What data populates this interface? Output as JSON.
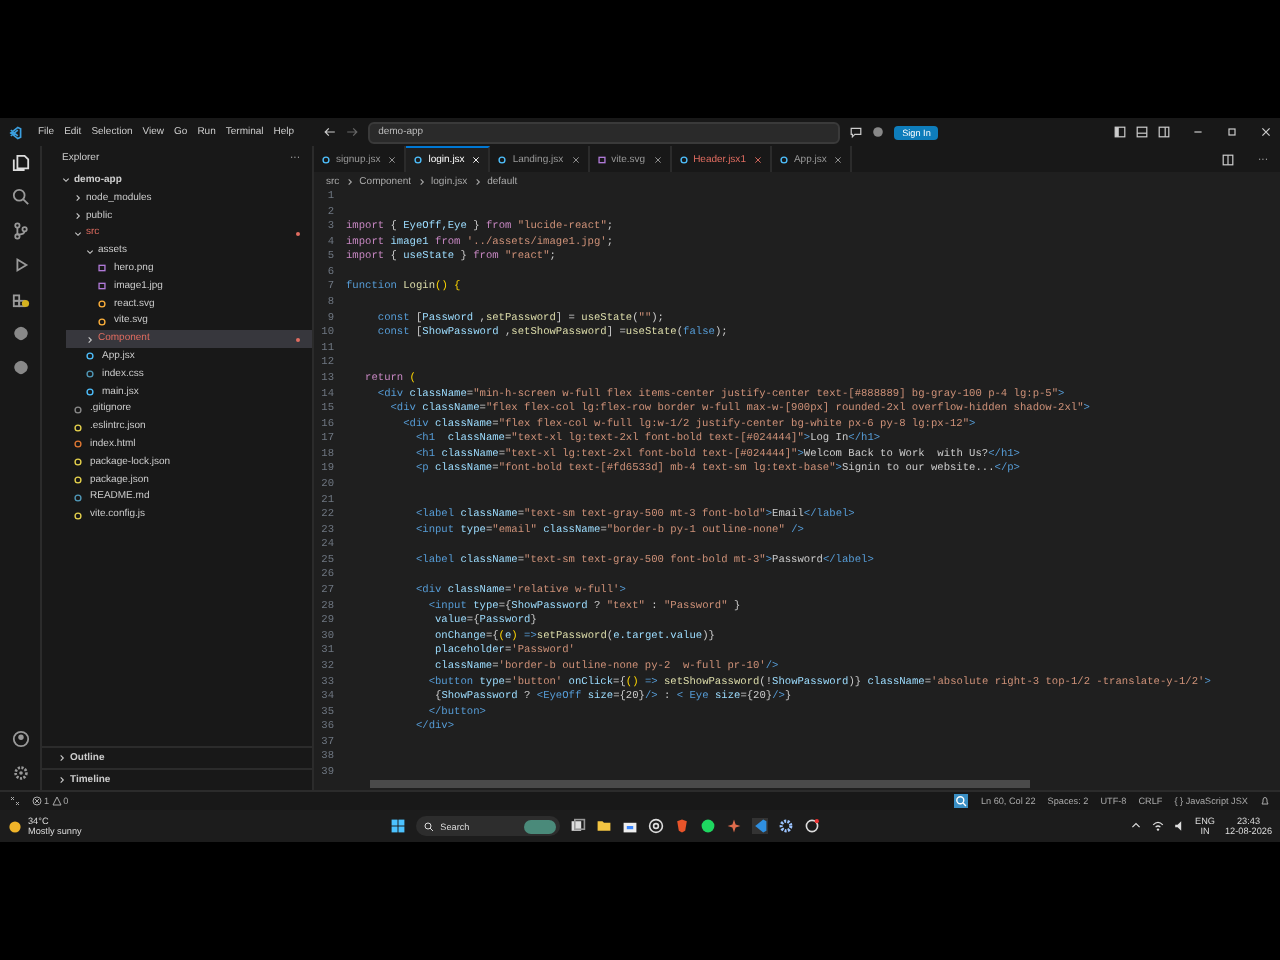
{
  "menu": [
    "File",
    "Edit",
    "Selection",
    "View",
    "Go",
    "Run",
    "Terminal",
    "Help"
  ],
  "command_center": {
    "value": "demo-app"
  },
  "sign_in": "Sign In",
  "tabs": [
    {
      "label": "signup.jsx",
      "selected": false,
      "error": false
    },
    {
      "label": "login.jsx",
      "selected": true,
      "error": false
    },
    {
      "label": "Landing.jsx",
      "selected": false,
      "error": false
    },
    {
      "label": "vite.svg",
      "selected": false,
      "error": false,
      "kind": "svg"
    },
    {
      "label": "Header.jsx",
      "selected": false,
      "error": true,
      "badge": "1"
    },
    {
      "label": "App.jsx",
      "selected": false,
      "error": false
    }
  ],
  "breadcrumb": [
    "src",
    "Component",
    "login.jsx",
    "default"
  ],
  "explorer": {
    "title": "Explorer",
    "more": "···",
    "tree": [
      {
        "label": "demo-app",
        "kind": "root",
        "expanded": true,
        "children": [
          {
            "label": "node_modules",
            "kind": "folder",
            "expanded": false,
            "selected": false,
            "modified": false
          },
          {
            "label": "public",
            "kind": "folder",
            "expanded": false,
            "selected": false,
            "modified": false
          },
          {
            "label": "src",
            "kind": "folder",
            "expanded": true,
            "selected": false,
            "modified": true,
            "children": [
              {
                "label": "assets",
                "kind": "folder",
                "expanded": true,
                "selected": false,
                "modified": false,
                "children": [
                  {
                    "label": "hero.png",
                    "kind": "image"
                  },
                  {
                    "label": "image1.jpg",
                    "kind": "image"
                  },
                  {
                    "label": "react.svg",
                    "kind": "svg"
                  },
                  {
                    "label": "vite.svg",
                    "kind": "svg"
                  }
                ]
              },
              {
                "label": "Component",
                "kind": "folder",
                "expanded": false,
                "selected": true,
                "modified": true
              },
              {
                "label": "App.jsx",
                "kind": "jsx"
              },
              {
                "label": "index.css",
                "kind": "css"
              },
              {
                "label": "main.jsx",
                "kind": "jsx"
              }
            ]
          },
          {
            "label": ".gitignore",
            "kind": "git"
          },
          {
            "label": ".eslintrc.json",
            "kind": "json"
          },
          {
            "label": "index.html",
            "kind": "html"
          },
          {
            "label": "package-lock.json",
            "kind": "json"
          },
          {
            "label": "package.json",
            "kind": "json"
          },
          {
            "label": "README.md",
            "kind": "md"
          },
          {
            "label": "vite.config.js",
            "kind": "js"
          }
        ]
      }
    ],
    "sections": [
      "Outline",
      "Timeline"
    ]
  },
  "code": [
    {
      "n": "1"
    },
    {
      "n": "2"
    },
    {
      "n": "3",
      "segs": [
        {
          "kind": "kw",
          "t": "import"
        },
        {
          "kind": "p",
          "t": " { "
        },
        {
          "kind": "var",
          "t": "EyeOff,Eye"
        },
        {
          "kind": "p",
          "t": " } "
        },
        {
          "kind": "kw",
          "t": "from"
        },
        {
          "kind": "str",
          "t": " \"lucide-react\""
        },
        {
          "kind": "p",
          "t": ";"
        }
      ]
    },
    {
      "n": "4",
      "segs": [
        {
          "kind": "kw",
          "t": "import"
        },
        {
          "kind": "var",
          "t": " image1 "
        },
        {
          "kind": "kw",
          "t": "from"
        },
        {
          "kind": "str",
          "t": " '../assets/image1.jpg'"
        },
        {
          "kind": "p",
          "t": ";"
        }
      ]
    },
    {
      "n": "5",
      "segs": [
        {
          "kind": "kw",
          "t": "import"
        },
        {
          "kind": "p",
          "t": " { "
        },
        {
          "kind": "var",
          "t": "useState"
        },
        {
          "kind": "p",
          "t": " } "
        },
        {
          "kind": "kw",
          "t": "from"
        },
        {
          "kind": "str",
          "t": " \"react\""
        },
        {
          "kind": "p",
          "t": ";"
        }
      ]
    },
    {
      "n": "6"
    },
    {
      "n": "7",
      "segs": [
        {
          "kind": "tag",
          "t": "function"
        },
        {
          "kind": "fn",
          "t": " Login"
        },
        {
          "kind": "brk",
          "t": "() {"
        }
      ]
    },
    {
      "n": "8"
    },
    {
      "n": "9",
      "segs": [
        {
          "kind": "tag",
          "t": "     const"
        },
        {
          "kind": "p",
          "t": " ["
        },
        {
          "kind": "var",
          "t": "Password"
        },
        {
          "kind": "p",
          "t": " ,"
        },
        {
          "kind": "fn",
          "t": "setPassword"
        },
        {
          "kind": "p",
          "t": "] = "
        },
        {
          "kind": "fn",
          "t": "useState"
        },
        {
          "kind": "p",
          "t": "("
        },
        {
          "kind": "str",
          "t": "\"\""
        },
        {
          "kind": "p",
          "t": ");"
        }
      ]
    },
    {
      "n": "10",
      "segs": [
        {
          "kind": "tag",
          "t": "     const"
        },
        {
          "kind": "p",
          "t": " ["
        },
        {
          "kind": "var",
          "t": "ShowPassword"
        },
        {
          "kind": "p",
          "t": " ,"
        },
        {
          "kind": "fn",
          "t": "setShowPassword"
        },
        {
          "kind": "p",
          "t": "] ="
        },
        {
          "kind": "fn",
          "t": "useState"
        },
        {
          "kind": "p",
          "t": "("
        },
        {
          "kind": "tag",
          "t": "false"
        },
        {
          "kind": "p",
          "t": ");"
        }
      ]
    },
    {
      "n": "11"
    },
    {
      "n": "12"
    },
    {
      "n": "13",
      "segs": [
        {
          "kind": "kw",
          "t": "   return"
        },
        {
          "kind": "brk",
          "t": " ("
        }
      ]
    },
    {
      "n": "14",
      "segs": [
        {
          "kind": "tag",
          "t": "     <div"
        },
        {
          "kind": "attr",
          "t": " className"
        },
        {
          "kind": "p",
          "t": "="
        },
        {
          "kind": "str",
          "t": "\"min-h-screen w-full flex items-center justify-center text-[#888889] bg-gray-100 p-4 lg:p-5\""
        },
        {
          "kind": "tag",
          "t": ">"
        }
      ]
    },
    {
      "n": "15",
      "segs": [
        {
          "kind": "tag",
          "t": "       <div"
        },
        {
          "kind": "attr",
          "t": " className"
        },
        {
          "kind": "p",
          "t": "="
        },
        {
          "kind": "str",
          "t": "\"flex flex-col lg:flex-row border w-full max-w-[900px] rounded-2xl overflow-hidden shadow-2xl\""
        },
        {
          "kind": "tag",
          "t": ">"
        }
      ]
    },
    {
      "n": "16",
      "segs": [
        {
          "kind": "tag",
          "t": "         <div"
        },
        {
          "kind": "attr",
          "t": " className"
        },
        {
          "kind": "p",
          "t": "="
        },
        {
          "kind": "str",
          "t": "\"flex flex-col w-full lg:w-1/2 justify-center bg-white px-6 py-8 lg:px-12\""
        },
        {
          "kind": "tag",
          "t": ">"
        }
      ]
    },
    {
      "n": "17",
      "segs": [
        {
          "kind": "tag",
          "t": "           <h1"
        },
        {
          "kind": "attr",
          "t": "  className"
        },
        {
          "kind": "p",
          "t": "="
        },
        {
          "kind": "str",
          "t": "\"text-xl lg:text-2xl font-bold text-[#024444]\""
        },
        {
          "kind": "tag",
          "t": ">"
        },
        {
          "kind": "p",
          "t": "Log In"
        },
        {
          "kind": "tag",
          "t": "</h1>"
        }
      ]
    },
    {
      "n": "18",
      "segs": [
        {
          "kind": "tag",
          "t": "           <h1"
        },
        {
          "kind": "attr",
          "t": " className"
        },
        {
          "kind": "p",
          "t": "="
        },
        {
          "kind": "str",
          "t": "\"text-xl lg:text-2xl font-bold text-[#024444]\""
        },
        {
          "kind": "tag",
          "t": ">"
        },
        {
          "kind": "p",
          "t": "Welcom Back to Work  with Us?"
        },
        {
          "kind": "tag",
          "t": "</h1>"
        }
      ]
    },
    {
      "n": "19",
      "segs": [
        {
          "kind": "tag",
          "t": "           <p"
        },
        {
          "kind": "attr",
          "t": " className"
        },
        {
          "kind": "p",
          "t": "="
        },
        {
          "kind": "str",
          "t": "\"font-bold text-[#fd6533d] mb-4 text-sm lg:text-base\""
        },
        {
          "kind": "tag",
          "t": ">"
        },
        {
          "kind": "p",
          "t": "Signin to our website..."
        },
        {
          "kind": "tag",
          "t": "</p>"
        }
      ]
    },
    {
      "n": "20"
    },
    {
      "n": "21"
    },
    {
      "n": "22",
      "segs": [
        {
          "kind": "tag",
          "t": "           <label"
        },
        {
          "kind": "attr",
          "t": " className"
        },
        {
          "kind": "p",
          "t": "="
        },
        {
          "kind": "str",
          "t": "\"text-sm text-gray-500 mt-3 font-bold\""
        },
        {
          "kind": "tag",
          "t": ">"
        },
        {
          "kind": "p",
          "t": "Email"
        },
        {
          "kind": "tag",
          "t": "</label>"
        }
      ]
    },
    {
      "n": "23",
      "segs": [
        {
          "kind": "tag",
          "t": "           <input"
        },
        {
          "kind": "attr",
          "t": " type"
        },
        {
          "kind": "p",
          "t": "="
        },
        {
          "kind": "str",
          "t": "\"email\""
        },
        {
          "kind": "attr",
          "t": " className"
        },
        {
          "kind": "p",
          "t": "="
        },
        {
          "kind": "str",
          "t": "\"border-b py-1 outline-none\""
        },
        {
          "kind": "tag",
          "t": " />"
        }
      ]
    },
    {
      "n": "24"
    },
    {
      "n": "25",
      "segs": [
        {
          "kind": "tag",
          "t": "           <label"
        },
        {
          "kind": "attr",
          "t": " className"
        },
        {
          "kind": "p",
          "t": "="
        },
        {
          "kind": "str",
          "t": "\"text-sm text-gray-500 font-bold mt-3\""
        },
        {
          "kind": "tag",
          "t": ">"
        },
        {
          "kind": "p",
          "t": "Password"
        },
        {
          "kind": "tag",
          "t": "</label>"
        }
      ]
    },
    {
      "n": "26"
    },
    {
      "n": "27",
      "segs": [
        {
          "kind": "tag",
          "t": "           <div"
        },
        {
          "kind": "attr",
          "t": " className"
        },
        {
          "kind": "p",
          "t": "="
        },
        {
          "kind": "str",
          "t": "'relative w-full'"
        },
        {
          "kind": "tag",
          "t": ">"
        }
      ]
    },
    {
      "n": "28",
      "segs": [
        {
          "kind": "tag",
          "t": "             <input"
        },
        {
          "kind": "attr",
          "t": " type"
        },
        {
          "kind": "p",
          "t": "={"
        },
        {
          "kind": "var",
          "t": "ShowPassword"
        },
        {
          "kind": "p",
          "t": " ? "
        },
        {
          "kind": "str",
          "t": "\"text\""
        },
        {
          "kind": "p",
          "t": " : "
        },
        {
          "kind": "str",
          "t": "\"Password\""
        },
        {
          "kind": "p",
          "t": " }"
        }
      ]
    },
    {
      "n": "29",
      "segs": [
        {
          "kind": "attr",
          "t": "              value"
        },
        {
          "kind": "p",
          "t": "={"
        },
        {
          "kind": "var",
          "t": "Password"
        },
        {
          "kind": "p",
          "t": "}"
        }
      ]
    },
    {
      "n": "30",
      "segs": [
        {
          "kind": "attr",
          "t": "              onChange"
        },
        {
          "kind": "p",
          "t": "={"
        },
        {
          "kind": "brk",
          "t": "("
        },
        {
          "kind": "var",
          "t": "e"
        },
        {
          "kind": "brk",
          "t": ")"
        },
        {
          "kind": "tag",
          "t": " =>"
        },
        {
          "kind": "fn",
          "t": "setPassword"
        },
        {
          "kind": "p",
          "t": "("
        },
        {
          "kind": "var",
          "t": "e.target.value"
        },
        {
          "kind": "p",
          "t": ")}"
        }
      ]
    },
    {
      "n": "31",
      "segs": [
        {
          "kind": "attr",
          "t": "              placeholder"
        },
        {
          "kind": "p",
          "t": "="
        },
        {
          "kind": "str",
          "t": "'Password'"
        }
      ]
    },
    {
      "n": "32",
      "segs": [
        {
          "kind": "attr",
          "t": "              className"
        },
        {
          "kind": "p",
          "t": "="
        },
        {
          "kind": "str",
          "t": "'border-b outline-none py-2  w-full pr-10'"
        },
        {
          "kind": "tag",
          "t": "/>"
        }
      ]
    },
    {
      "n": "33",
      "segs": [
        {
          "kind": "tag",
          "t": "             <button"
        },
        {
          "kind": "attr",
          "t": " type"
        },
        {
          "kind": "p",
          "t": "="
        },
        {
          "kind": "str",
          "t": "'button'"
        },
        {
          "kind": "attr",
          "t": " onClick"
        },
        {
          "kind": "p",
          "t": "={"
        },
        {
          "kind": "brk",
          "t": "()"
        },
        {
          "kind": "tag",
          "t": " =>"
        },
        {
          "kind": "fn",
          "t": " setShowPassword"
        },
        {
          "kind": "p",
          "t": "(!"
        },
        {
          "kind": "var",
          "t": "ShowPassword"
        },
        {
          "kind": "p",
          "t": ")}"
        },
        {
          "kind": "attr",
          "t": " className"
        },
        {
          "kind": "p",
          "t": "="
        },
        {
          "kind": "str",
          "t": "'absolute right-3 top-1/2 -translate-y-1/2'"
        },
        {
          "kind": "tag",
          "t": ">"
        }
      ]
    },
    {
      "n": "34",
      "segs": [
        {
          "kind": "p",
          "t": "              {"
        },
        {
          "kind": "var",
          "t": "ShowPassword"
        },
        {
          "kind": "p",
          "t": " ? "
        },
        {
          "kind": "tag",
          "t": "<EyeOff"
        },
        {
          "kind": "attr",
          "t": " size"
        },
        {
          "kind": "p",
          "t": "={20}"
        },
        {
          "kind": "tag",
          "t": "/>"
        },
        {
          "kind": "p",
          "t": " : "
        },
        {
          "kind": "tag",
          "t": "< Eye"
        },
        {
          "kind": "attr",
          "t": " size"
        },
        {
          "kind": "p",
          "t": "={20}"
        },
        {
          "kind": "tag",
          "t": "/>"
        },
        {
          "kind": "p",
          "t": "}"
        }
      ]
    },
    {
      "n": "35",
      "segs": [
        {
          "kind": "tag",
          "t": "             </button>"
        }
      ]
    },
    {
      "n": "36",
      "segs": [
        {
          "kind": "tag",
          "t": "           </div>"
        }
      ]
    },
    {
      "n": "37"
    },
    {
      "n": "38"
    },
    {
      "n": "39"
    }
  ],
  "status_bar": {
    "errors": "1",
    "warnings": "0",
    "right": [
      "Ln 60, Col 22",
      "Spaces: 2",
      "UTF-8",
      "CRLF",
      "{ } JavaScript JSX"
    ]
  },
  "taskbar": {
    "weather": {
      "temp": "34°C",
      "condition": "Mostly sunny"
    },
    "search": {
      "placeholder": "Search"
    },
    "language": [
      "ENG",
      "IN"
    ],
    "time": "23:43",
    "date": "12-08-2026"
  }
}
